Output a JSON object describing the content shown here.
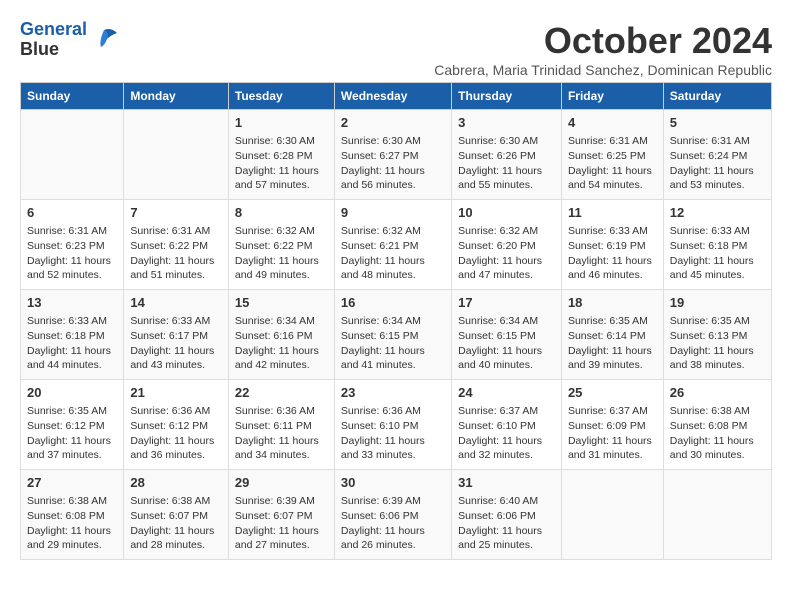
{
  "logo": {
    "line1": "General",
    "line2": "Blue"
  },
  "title": "October 2024",
  "subtitle": "Cabrera, Maria Trinidad Sanchez, Dominican Republic",
  "days_of_week": [
    "Sunday",
    "Monday",
    "Tuesday",
    "Wednesday",
    "Thursday",
    "Friday",
    "Saturday"
  ],
  "weeks": [
    [
      {
        "day": "",
        "info": ""
      },
      {
        "day": "",
        "info": ""
      },
      {
        "day": "1",
        "info": "Sunrise: 6:30 AM\nSunset: 6:28 PM\nDaylight: 11 hours and 57 minutes."
      },
      {
        "day": "2",
        "info": "Sunrise: 6:30 AM\nSunset: 6:27 PM\nDaylight: 11 hours and 56 minutes."
      },
      {
        "day": "3",
        "info": "Sunrise: 6:30 AM\nSunset: 6:26 PM\nDaylight: 11 hours and 55 minutes."
      },
      {
        "day": "4",
        "info": "Sunrise: 6:31 AM\nSunset: 6:25 PM\nDaylight: 11 hours and 54 minutes."
      },
      {
        "day": "5",
        "info": "Sunrise: 6:31 AM\nSunset: 6:24 PM\nDaylight: 11 hours and 53 minutes."
      }
    ],
    [
      {
        "day": "6",
        "info": "Sunrise: 6:31 AM\nSunset: 6:23 PM\nDaylight: 11 hours and 52 minutes."
      },
      {
        "day": "7",
        "info": "Sunrise: 6:31 AM\nSunset: 6:22 PM\nDaylight: 11 hours and 51 minutes."
      },
      {
        "day": "8",
        "info": "Sunrise: 6:32 AM\nSunset: 6:22 PM\nDaylight: 11 hours and 49 minutes."
      },
      {
        "day": "9",
        "info": "Sunrise: 6:32 AM\nSunset: 6:21 PM\nDaylight: 11 hours and 48 minutes."
      },
      {
        "day": "10",
        "info": "Sunrise: 6:32 AM\nSunset: 6:20 PM\nDaylight: 11 hours and 47 minutes."
      },
      {
        "day": "11",
        "info": "Sunrise: 6:33 AM\nSunset: 6:19 PM\nDaylight: 11 hours and 46 minutes."
      },
      {
        "day": "12",
        "info": "Sunrise: 6:33 AM\nSunset: 6:18 PM\nDaylight: 11 hours and 45 minutes."
      }
    ],
    [
      {
        "day": "13",
        "info": "Sunrise: 6:33 AM\nSunset: 6:18 PM\nDaylight: 11 hours and 44 minutes."
      },
      {
        "day": "14",
        "info": "Sunrise: 6:33 AM\nSunset: 6:17 PM\nDaylight: 11 hours and 43 minutes."
      },
      {
        "day": "15",
        "info": "Sunrise: 6:34 AM\nSunset: 6:16 PM\nDaylight: 11 hours and 42 minutes."
      },
      {
        "day": "16",
        "info": "Sunrise: 6:34 AM\nSunset: 6:15 PM\nDaylight: 11 hours and 41 minutes."
      },
      {
        "day": "17",
        "info": "Sunrise: 6:34 AM\nSunset: 6:15 PM\nDaylight: 11 hours and 40 minutes."
      },
      {
        "day": "18",
        "info": "Sunrise: 6:35 AM\nSunset: 6:14 PM\nDaylight: 11 hours and 39 minutes."
      },
      {
        "day": "19",
        "info": "Sunrise: 6:35 AM\nSunset: 6:13 PM\nDaylight: 11 hours and 38 minutes."
      }
    ],
    [
      {
        "day": "20",
        "info": "Sunrise: 6:35 AM\nSunset: 6:12 PM\nDaylight: 11 hours and 37 minutes."
      },
      {
        "day": "21",
        "info": "Sunrise: 6:36 AM\nSunset: 6:12 PM\nDaylight: 11 hours and 36 minutes."
      },
      {
        "day": "22",
        "info": "Sunrise: 6:36 AM\nSunset: 6:11 PM\nDaylight: 11 hours and 34 minutes."
      },
      {
        "day": "23",
        "info": "Sunrise: 6:36 AM\nSunset: 6:10 PM\nDaylight: 11 hours and 33 minutes."
      },
      {
        "day": "24",
        "info": "Sunrise: 6:37 AM\nSunset: 6:10 PM\nDaylight: 11 hours and 32 minutes."
      },
      {
        "day": "25",
        "info": "Sunrise: 6:37 AM\nSunset: 6:09 PM\nDaylight: 11 hours and 31 minutes."
      },
      {
        "day": "26",
        "info": "Sunrise: 6:38 AM\nSunset: 6:08 PM\nDaylight: 11 hours and 30 minutes."
      }
    ],
    [
      {
        "day": "27",
        "info": "Sunrise: 6:38 AM\nSunset: 6:08 PM\nDaylight: 11 hours and 29 minutes."
      },
      {
        "day": "28",
        "info": "Sunrise: 6:38 AM\nSunset: 6:07 PM\nDaylight: 11 hours and 28 minutes."
      },
      {
        "day": "29",
        "info": "Sunrise: 6:39 AM\nSunset: 6:07 PM\nDaylight: 11 hours and 27 minutes."
      },
      {
        "day": "30",
        "info": "Sunrise: 6:39 AM\nSunset: 6:06 PM\nDaylight: 11 hours and 26 minutes."
      },
      {
        "day": "31",
        "info": "Sunrise: 6:40 AM\nSunset: 6:06 PM\nDaylight: 11 hours and 25 minutes."
      },
      {
        "day": "",
        "info": ""
      },
      {
        "day": "",
        "info": ""
      }
    ]
  ]
}
